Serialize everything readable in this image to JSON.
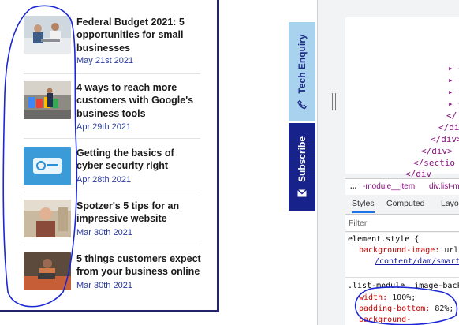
{
  "articles": [
    {
      "title": "Federal Budget 2021: 5 opportunities for small businesses",
      "date": "May 21st 2021",
      "thumb": "meeting-photo"
    },
    {
      "title": "4 ways to reach more customers with Google's business tools",
      "date": "Apr 29th 2021",
      "thumb": "google-sign-photo"
    },
    {
      "title": "Getting the basics of cyber security right",
      "date": "Apr 28th 2021",
      "thumb": "cyber-security-photo"
    },
    {
      "title": "Spotzer's 5 tips for an impressive website",
      "date": "Mar 30th 2021",
      "thumb": "man-portrait-photo"
    },
    {
      "title": "5 things customers expect from your business online",
      "date": "Mar 30th 2021",
      "thumb": "person-laptop-photo"
    }
  ],
  "side_tabs": {
    "enquiry": "Tech Enquiry",
    "subscribe": "Subscribe"
  },
  "devtools": {
    "tree_lines": [
      "▸ </",
      "▸ </",
      "▸ </",
      "▸ </",
      "</",
      "</di",
      "</div>",
      "</div>",
      "</sectio",
      "</div"
    ],
    "breadcrumb_ellipsis": "...",
    "breadcrumb_item": "-module__item",
    "breadcrumb_item2": "div.list-m",
    "tabs": [
      "Styles",
      "Computed",
      "Layo"
    ],
    "filter_placeholder": "Filter",
    "rule1_selector": "element.style {",
    "rule1_prop": "background-image:",
    "rule1_val": "url",
    "rule1_link": "/content/dam/smart",
    "rule2_selector": ".list-module__image-back",
    "rule2_prop1": "width:",
    "rule2_val1": "100%;",
    "rule2_prop2": "padding-bottom:",
    "rule2_val2": "82%;",
    "rule2_prop3": "background-"
  },
  "colors": {
    "brand": "#17238a",
    "accent_light": "#a9d2ef",
    "annotation": "#1b27d6",
    "date": "#2a3b9e"
  }
}
